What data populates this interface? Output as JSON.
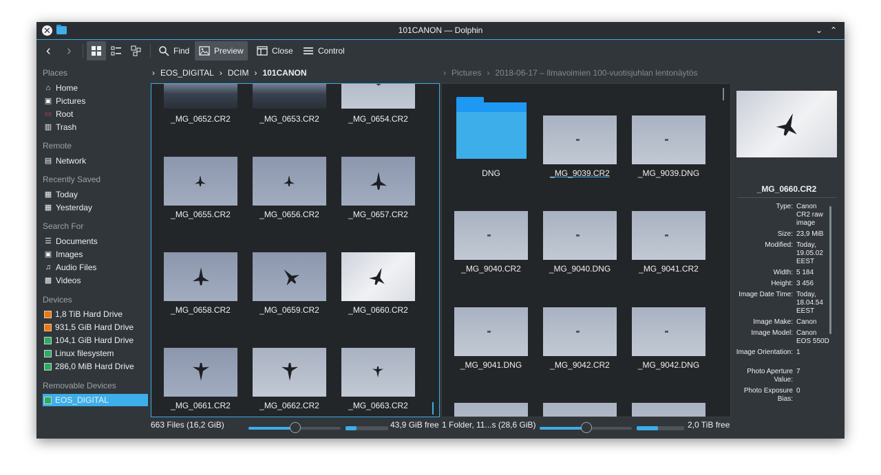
{
  "window": {
    "title": "101CANON — Dolphin",
    "close_glyph": "✕",
    "minimize_glyph": "⌄",
    "maximize_glyph": "⌃"
  },
  "toolbar": {
    "back_glyph": "‹",
    "forward_glyph": "›",
    "find_label": "Find",
    "preview_label": "Preview",
    "close_label": "Close",
    "control_label": "Control"
  },
  "sidebar": {
    "places_title": "Places",
    "places": [
      {
        "label": "Home",
        "icon": "home-icon",
        "glyph": "⌂"
      },
      {
        "label": "Pictures",
        "icon": "pictures-icon",
        "glyph": "▣"
      },
      {
        "label": "Root",
        "icon": "root-folder-icon",
        "glyph": "▭"
      },
      {
        "label": "Trash",
        "icon": "trash-icon",
        "glyph": "▥"
      }
    ],
    "remote_title": "Remote",
    "remote": [
      {
        "label": "Network",
        "icon": "network-icon",
        "glyph": "▤"
      }
    ],
    "recent_title": "Recently Saved",
    "recent": [
      {
        "label": "Today",
        "icon": "calendar-icon",
        "glyph": "▦"
      },
      {
        "label": "Yesterday",
        "icon": "calendar-icon",
        "glyph": "▦"
      }
    ],
    "search_title": "Search For",
    "search": [
      {
        "label": "Documents",
        "icon": "documents-icon",
        "glyph": "☰"
      },
      {
        "label": "Images",
        "icon": "images-icon",
        "glyph": "▣"
      },
      {
        "label": "Audio Files",
        "icon": "audio-icon",
        "glyph": "♫"
      },
      {
        "label": "Videos",
        "icon": "videos-icon",
        "glyph": "▩"
      }
    ],
    "devices_title": "Devices",
    "devices": [
      {
        "label": "1,8 TiB Hard Drive"
      },
      {
        "label": "931,5 GiB Hard Drive"
      },
      {
        "label": "104,1 GiB Hard Drive"
      },
      {
        "label": "Linux filesystem"
      },
      {
        "label": "286,0 MiB Hard Drive"
      }
    ],
    "removable_title": "Removable Devices",
    "removable": [
      {
        "label": "EOS_DIGITAL"
      }
    ]
  },
  "left_pane": {
    "breadcrumb": [
      "EOS_DIGITAL",
      "DCIM",
      "101CANON"
    ],
    "separator": "›",
    "files": [
      "_MG_0652.CR2",
      "_MG_0653.CR2",
      "_MG_0654.CR2",
      "_MG_0655.CR2",
      "_MG_0656.CR2",
      "_MG_0657.CR2",
      "_MG_0658.CR2",
      "_MG_0659.CR2",
      "_MG_0660.CR2",
      "_MG_0661.CR2",
      "_MG_0662.CR2",
      "_MG_0663.CR2"
    ],
    "status": "663 Files (16,2 GiB)",
    "free": "43,9 GiB free",
    "zoom_fraction": 0.5,
    "capacity_used_fraction": 0.25
  },
  "right_pane": {
    "breadcrumb": [
      "Pictures",
      "2018-06-17 – Ilmavoimien 100-vuotisjuhlan lentonäytös"
    ],
    "items": [
      "DNG",
      "_MG_9039.CR2",
      "_MG_9039.DNG",
      "_MG_9040.CR2",
      "_MG_9040.DNG",
      "_MG_9041.CR2",
      "_MG_9041.DNG",
      "_MG_9042.CR2",
      "_MG_9042.DNG"
    ],
    "status": "1 Folder, 11...s (28,6 GiB)",
    "free": "2,0 TiB free",
    "zoom_fraction": 0.5,
    "capacity_used_fraction": 0.45
  },
  "info_panel": {
    "filename": "_MG_0660.CR2",
    "fields": [
      {
        "key": "Type:",
        "value": "Canon CR2 raw image"
      },
      {
        "key": "Size:",
        "value": "23,9 MiB"
      },
      {
        "key": "Modified:",
        "value": "Today, 19.05.02 EEST"
      },
      {
        "key": "Width:",
        "value": "5 184"
      },
      {
        "key": "Height:",
        "value": "3 456"
      },
      {
        "key": "Image Date Time:",
        "value": "Today, 18.04.54 EEST"
      },
      {
        "key": "Image Make:",
        "value": "Canon"
      },
      {
        "key": "Image Model:",
        "value": "Canon EOS 550D"
      },
      {
        "key": "Image Orientation:",
        "value": "1"
      },
      {
        "key": "Photo Aperture Value:",
        "value": "7"
      },
      {
        "key": "Photo Exposure Bias:",
        "value": "0"
      }
    ]
  },
  "colors": {
    "window_bg": "#31363b",
    "view_bg": "#232629",
    "accent": "#3daee9",
    "text": "#eff0f1",
    "muted": "#9ea3a7"
  }
}
